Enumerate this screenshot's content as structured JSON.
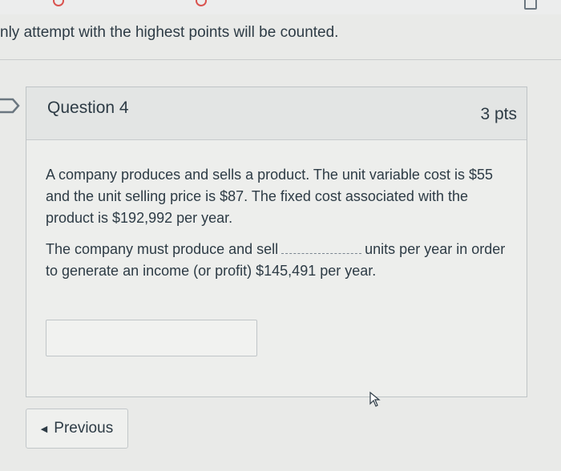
{
  "notice": "nly attempt with the highest points will be counted.",
  "question": {
    "title": "Question 4",
    "points": "3 pts",
    "paragraph1": "A company produces and sells a product. The unit variable cost is $55 and the unit selling price is $87. The fixed cost associated with the product is $192,992 per year.",
    "paragraph2_before": "The company must produce and sell",
    "paragraph2_after": "units per year in order to generate an income (or profit) $145,491 per year.",
    "answer_value": ""
  },
  "nav": {
    "previous_label": "Previous",
    "previous_icon": "triangle-left-icon"
  },
  "colors": {
    "background": "#e9eae8",
    "text": "#2d3b45",
    "accent_red": "#d9534f"
  }
}
